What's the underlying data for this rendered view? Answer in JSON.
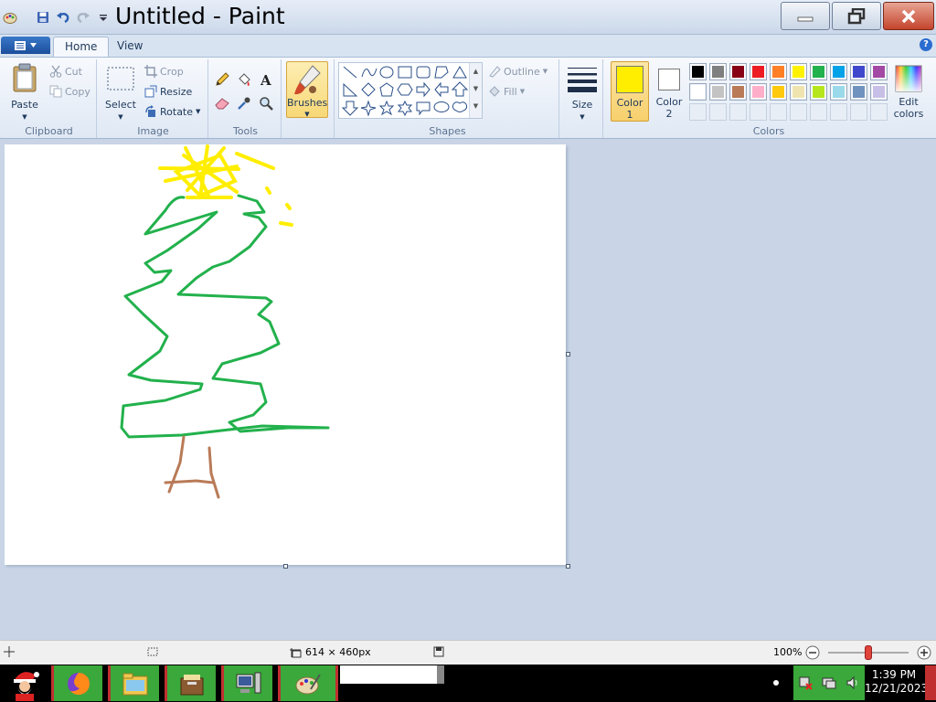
{
  "window": {
    "title": "Untitled - Paint"
  },
  "tabs": [
    {
      "label": "Home"
    },
    {
      "label": "View"
    }
  ],
  "ribbon": {
    "clipboard": {
      "label": "Clipboard",
      "paste": "Paste",
      "cut": "Cut",
      "copy": "Copy"
    },
    "image": {
      "label": "Image",
      "select": "Select",
      "crop": "Crop",
      "resize": "Resize",
      "rotate": "Rotate"
    },
    "tools": {
      "label": "Tools"
    },
    "brushes": {
      "label": "Brushes"
    },
    "shapes": {
      "label": "Shapes",
      "outline": "Outline",
      "fill": "Fill"
    },
    "size": {
      "label": "Size"
    },
    "colors": {
      "label": "Colors",
      "color1_label": "Color",
      "color1_num": "1",
      "color2_label": "Color",
      "color2_num": "2",
      "edit_label": "Edit",
      "edit_label2": "colors",
      "color1": "#ffee00",
      "color2": "#ffffff",
      "palette_row1": [
        "#000000",
        "#7f7f7f",
        "#880015",
        "#ed1c24",
        "#ff7f27",
        "#fff200",
        "#22b14c",
        "#00a2e8",
        "#3f48cc",
        "#a349a4"
      ],
      "palette_row2": [
        "#ffffff",
        "#c3c3c3",
        "#b97a57",
        "#ffaec9",
        "#ffc90e",
        "#efe4b0",
        "#b5e61d",
        "#99d9ea",
        "#7092be",
        "#c8bfe7"
      ]
    }
  },
  "statusbar": {
    "canvas_size": "614 × 460px",
    "zoom": "100%",
    "zoom_level_fraction": 0.5
  },
  "taskbar": {
    "time": "1:39 PM",
    "date": "12/21/2023"
  }
}
